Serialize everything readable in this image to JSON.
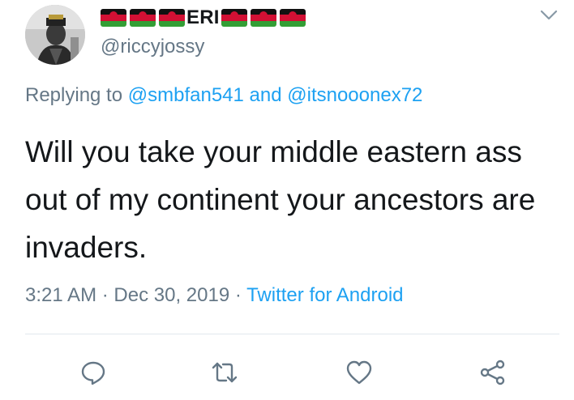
{
  "user": {
    "display_name": "ERI",
    "handle": "@riccyjossy",
    "flag_colors": [
      "#111111",
      "#d21034",
      "#339e35"
    ]
  },
  "reply": {
    "prefix": "Replying to",
    "user1": "@smbfan541",
    "joiner": "and",
    "user2": "@itsnooonex72"
  },
  "tweet": {
    "text": "Will you take your middle eastern ass out of my continent your ancestors are invaders."
  },
  "meta": {
    "time": "3:21 AM",
    "sep1": "·",
    "date": "Dec 30, 2019",
    "sep2": "·",
    "source": "Twitter for Android"
  },
  "icons": {
    "menu": "chevron-down-icon",
    "reply": "reply-icon",
    "retweet": "retweet-icon",
    "like": "like-icon",
    "share": "share-icon"
  },
  "colors": {
    "link": "#1da1f2",
    "muted": "#657786",
    "text": "#14171a",
    "divider": "#e1e8ed"
  }
}
